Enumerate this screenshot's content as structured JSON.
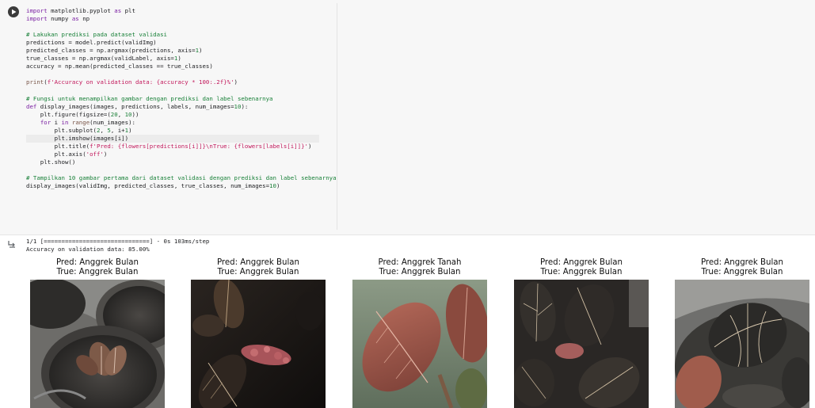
{
  "cell": {
    "run_icon": "play-icon",
    "code_lines": [
      {
        "t": "import matplotlib.pyplot as plt"
      },
      {
        "t": "import numpy as np"
      },
      {
        "t": ""
      },
      {
        "t": "# Lakukan prediksi pada dataset validasi"
      },
      {
        "t": "predictions = model.predict(validImg)"
      },
      {
        "t": "predicted_classes = np.argmax(predictions, axis=1)"
      },
      {
        "t": "true_classes = np.argmax(validLabel, axis=1)"
      },
      {
        "t": "accuracy = np.mean(predicted_classes == true_classes)"
      },
      {
        "t": ""
      },
      {
        "t": "print(f'Accuracy on validation data: {accuracy * 100:.2f}%')"
      },
      {
        "t": ""
      },
      {
        "t": "# Fungsi untuk menampilkan gambar dengan prediksi dan label sebenarnya"
      },
      {
        "t": "def display_images(images, predictions, labels, num_images=10):"
      },
      {
        "t": "    plt.figure(figsize=(20, 10))"
      },
      {
        "t": "    for i in range(num_images):"
      },
      {
        "t": "        plt.subplot(2, 5, i+1)"
      },
      {
        "t": "        plt.imshow(images[i])"
      },
      {
        "t": "        plt.title(f'Pred: {flowers[predictions[i]]}\\nTrue: {flowers[labels[i]]}')"
      },
      {
        "t": "        plt.axis('off')"
      },
      {
        "t": "    plt.show()"
      },
      {
        "t": ""
      },
      {
        "t": "# Tampilkan 10 gambar pertama dari dataset validasi dengan prediksi dan label sebenarnya"
      },
      {
        "t": "display_images(validImg, predicted_classes, true_classes, num_images=10)"
      }
    ]
  },
  "output": {
    "icon": "output-toggle-icon",
    "progress_line": "1/1 [==============================] - 0s 103ms/step",
    "accuracy_line": "Accuracy on validation data: 85.00%",
    "panels": [
      {
        "pred": "Pred: Anggrek Bulan",
        "true": "True: Anggrek Bulan"
      },
      {
        "pred": "Pred: Anggrek Bulan",
        "true": "True: Anggrek Bulan"
      },
      {
        "pred": "Pred: Anggrek Tanah",
        "true": "True: Anggrek Bulan"
      },
      {
        "pred": "Pred: Anggrek Bulan",
        "true": "True: Anggrek Bulan"
      },
      {
        "pred": "Pred: Anggrek Bulan",
        "true": "True: Anggrek Bulan"
      }
    ]
  },
  "colors": {
    "cell_bg": "#f7f7f7",
    "keyword": "#7a1fa2",
    "comment": "#188038",
    "string": "#c2185b",
    "number": "#1a7f37"
  }
}
